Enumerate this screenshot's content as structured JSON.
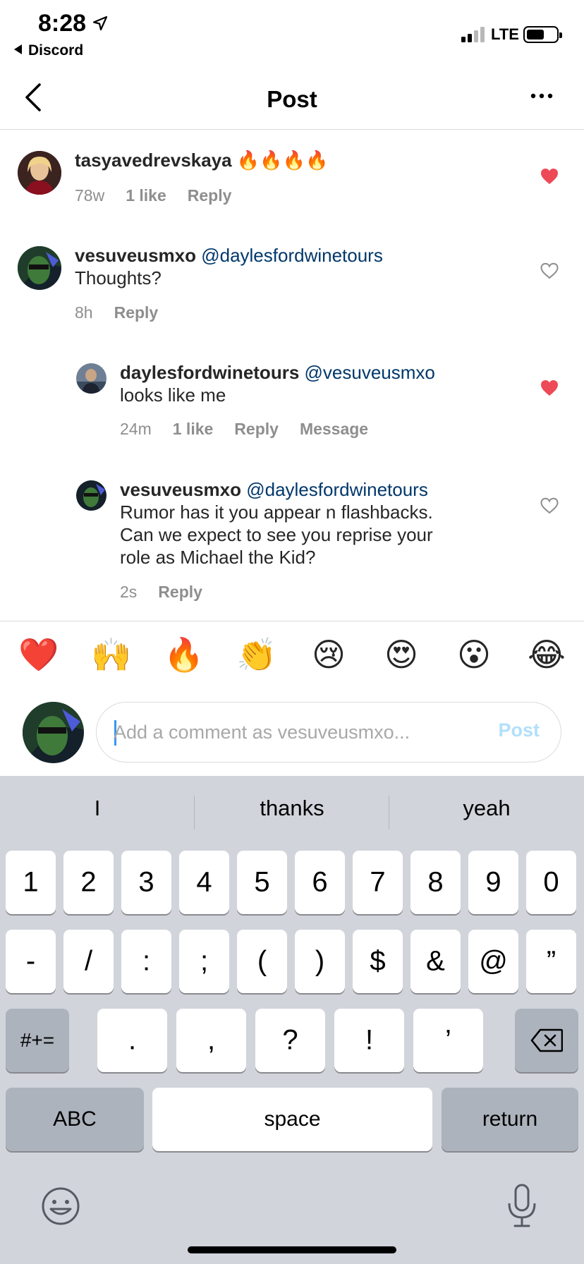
{
  "status_bar": {
    "time": "8:28",
    "back_app": "Discord",
    "network": "LTE"
  },
  "header": {
    "title": "Post"
  },
  "comments": [
    {
      "username": "tasyavedrevskaya",
      "text": "🔥🔥🔥🔥",
      "time": "78w",
      "likes": "1 like",
      "reply": "Reply",
      "liked": true
    },
    {
      "username": "vesuveusmxo",
      "mention": "@daylesfordwinetours",
      "text": "Thoughts?",
      "time": "8h",
      "reply": "Reply",
      "liked": false
    },
    {
      "username": "daylesfordwinetours",
      "mention": "@vesuveusmxo",
      "text": "looks like me",
      "time": "24m",
      "likes": "1 like",
      "reply": "Reply",
      "message": "Message",
      "liked": true
    },
    {
      "username": "vesuveusmxo",
      "mention": "@daylesfordwinetours",
      "text_lines": [
        "Rumor has it you appear n flashbacks.",
        "Can we expect to see you reprise your",
        "role as Michael the Kid?"
      ],
      "time": "2s",
      "reply": "Reply",
      "liked": false
    }
  ],
  "emoji_bar": [
    "❤️",
    "🙌",
    "🔥",
    "👏",
    "😢",
    "😍",
    "😮",
    "😂"
  ],
  "comment_input": {
    "placeholder": "Add a comment as vesuveusmxo...",
    "post_label": "Post"
  },
  "keyboard": {
    "suggestions": [
      "I",
      "thanks",
      "yeah"
    ],
    "row1": [
      "1",
      "2",
      "3",
      "4",
      "5",
      "6",
      "7",
      "8",
      "9",
      "0"
    ],
    "row2": [
      "-",
      "/",
      ":",
      ";",
      "(",
      ")",
      "$",
      "&",
      "@",
      "”"
    ],
    "row3_toggle": "#+=",
    "row3": [
      ".",
      ",",
      "?",
      "!",
      "’"
    ],
    "abc": "ABC",
    "space": "space",
    "return": "return"
  },
  "colors": {
    "liked_heart": "#ed4956",
    "mention": "#00376b",
    "post_disabled": "#b2dffc",
    "keyboard_bg": "#d1d4db"
  }
}
